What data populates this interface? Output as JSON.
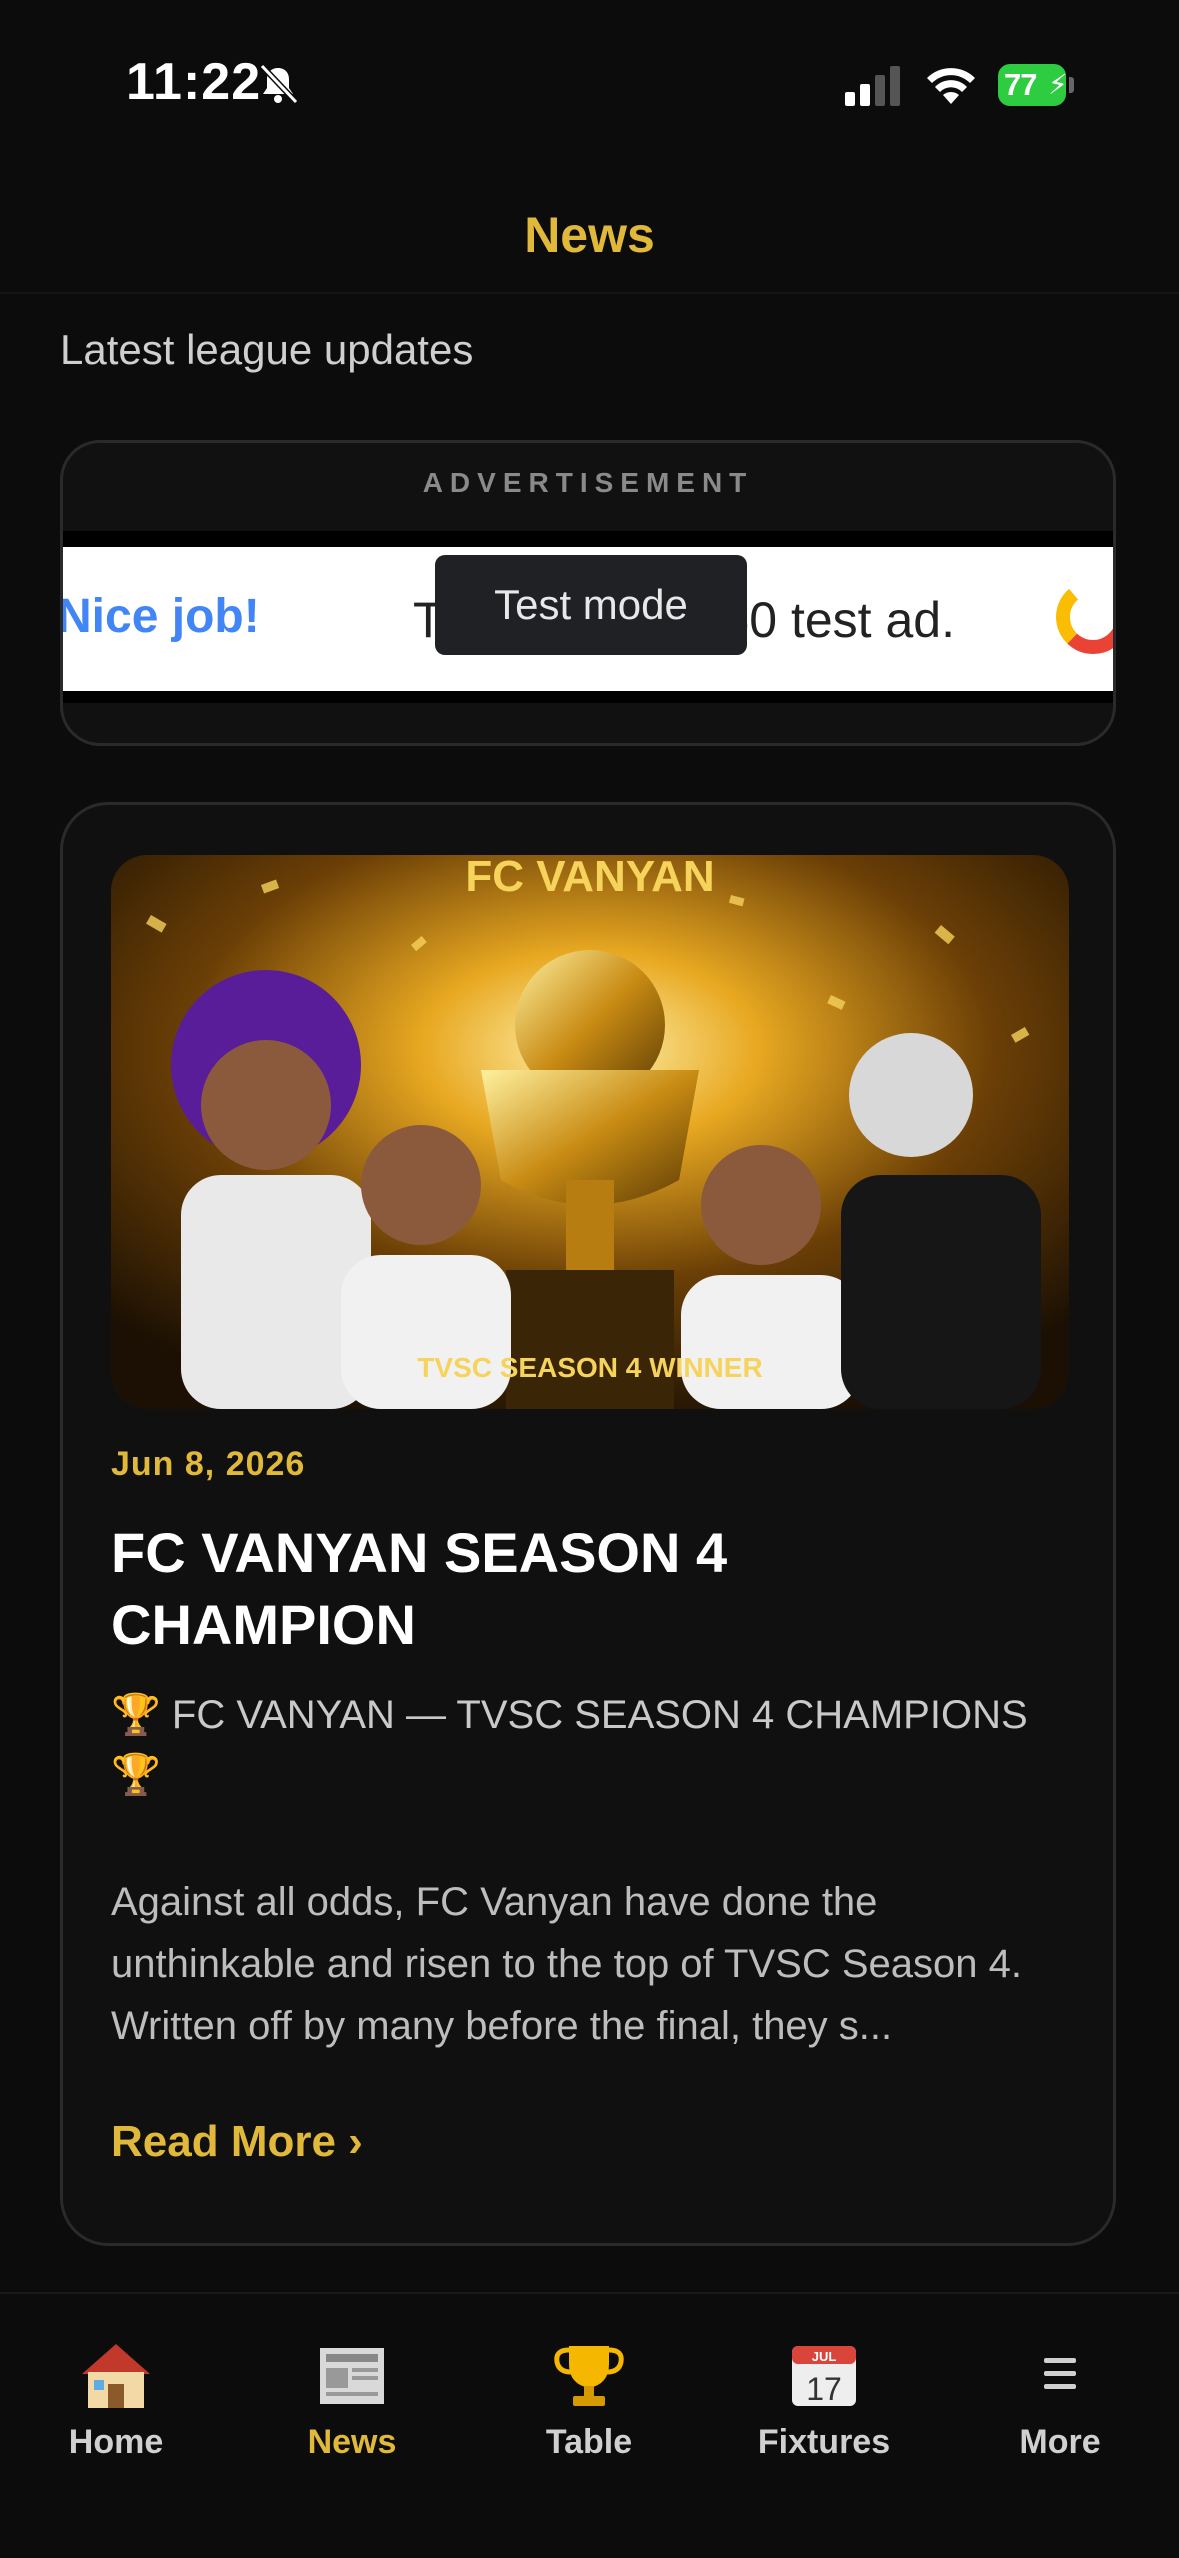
{
  "status_bar": {
    "time": "11:22",
    "battery": "77",
    "icons": [
      "bell-slash-icon",
      "signal-icon",
      "wifi-icon",
      "battery-charging-icon"
    ]
  },
  "header": {
    "title": "News"
  },
  "subtitle": "Latest league updates",
  "ad": {
    "label": "ADVERTISEMENT",
    "nice": "Nice job!",
    "text": "This is a 320x50 test ad.",
    "test_mode": "Test mode"
  },
  "news": {
    "image_caption_top": "FC VANYAN",
    "image_caption_bottom": "TVSC SEASON 4 WINNER",
    "date": "Jun 8, 2026",
    "title": "FC VANYAN SEASON 4 CHAMPION",
    "lead": "🏆 FC VANYAN — TVSC SEASON 4 CHAMPIONS 🏆",
    "body": "Against all odds, FC Vanyan have done the unthinkable and risen to the top of TVSC Season 4. Written off by many before the final, they s...",
    "read_more": "Read More ›"
  },
  "tabs": [
    {
      "label": "Home",
      "icon": "house-icon",
      "active": false
    },
    {
      "label": "News",
      "icon": "newspaper-icon",
      "active": true
    },
    {
      "label": "Table",
      "icon": "trophy-icon",
      "active": false
    },
    {
      "label": "Fixtures",
      "icon": "calendar-icon",
      "active": false
    },
    {
      "label": "More",
      "icon": "menu-icon",
      "active": false
    }
  ],
  "calendar_icon": {
    "month": "JUL",
    "day": "17"
  },
  "colors": {
    "accent": "#e0b93a",
    "background": "#0c0c0d",
    "card": "#101011"
  }
}
